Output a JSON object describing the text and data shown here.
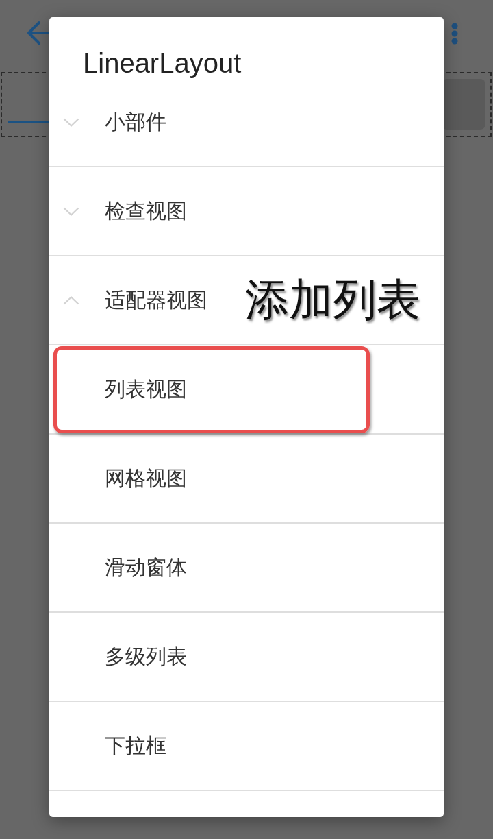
{
  "dialog": {
    "title": "LinearLayout",
    "groups": [
      {
        "label": "小部件",
        "expanded": false
      },
      {
        "label": "检查视图",
        "expanded": false
      },
      {
        "label": "适配器视图",
        "expanded": true,
        "children": [
          {
            "label": "列表视图",
            "highlighted": true
          },
          {
            "label": "网格视图",
            "highlighted": false
          },
          {
            "label": "滑动窗体",
            "highlighted": false
          },
          {
            "label": "多级列表",
            "highlighted": false
          },
          {
            "label": "下拉框",
            "highlighted": false
          }
        ]
      }
    ]
  },
  "annotation": {
    "callout": "添加列表"
  }
}
